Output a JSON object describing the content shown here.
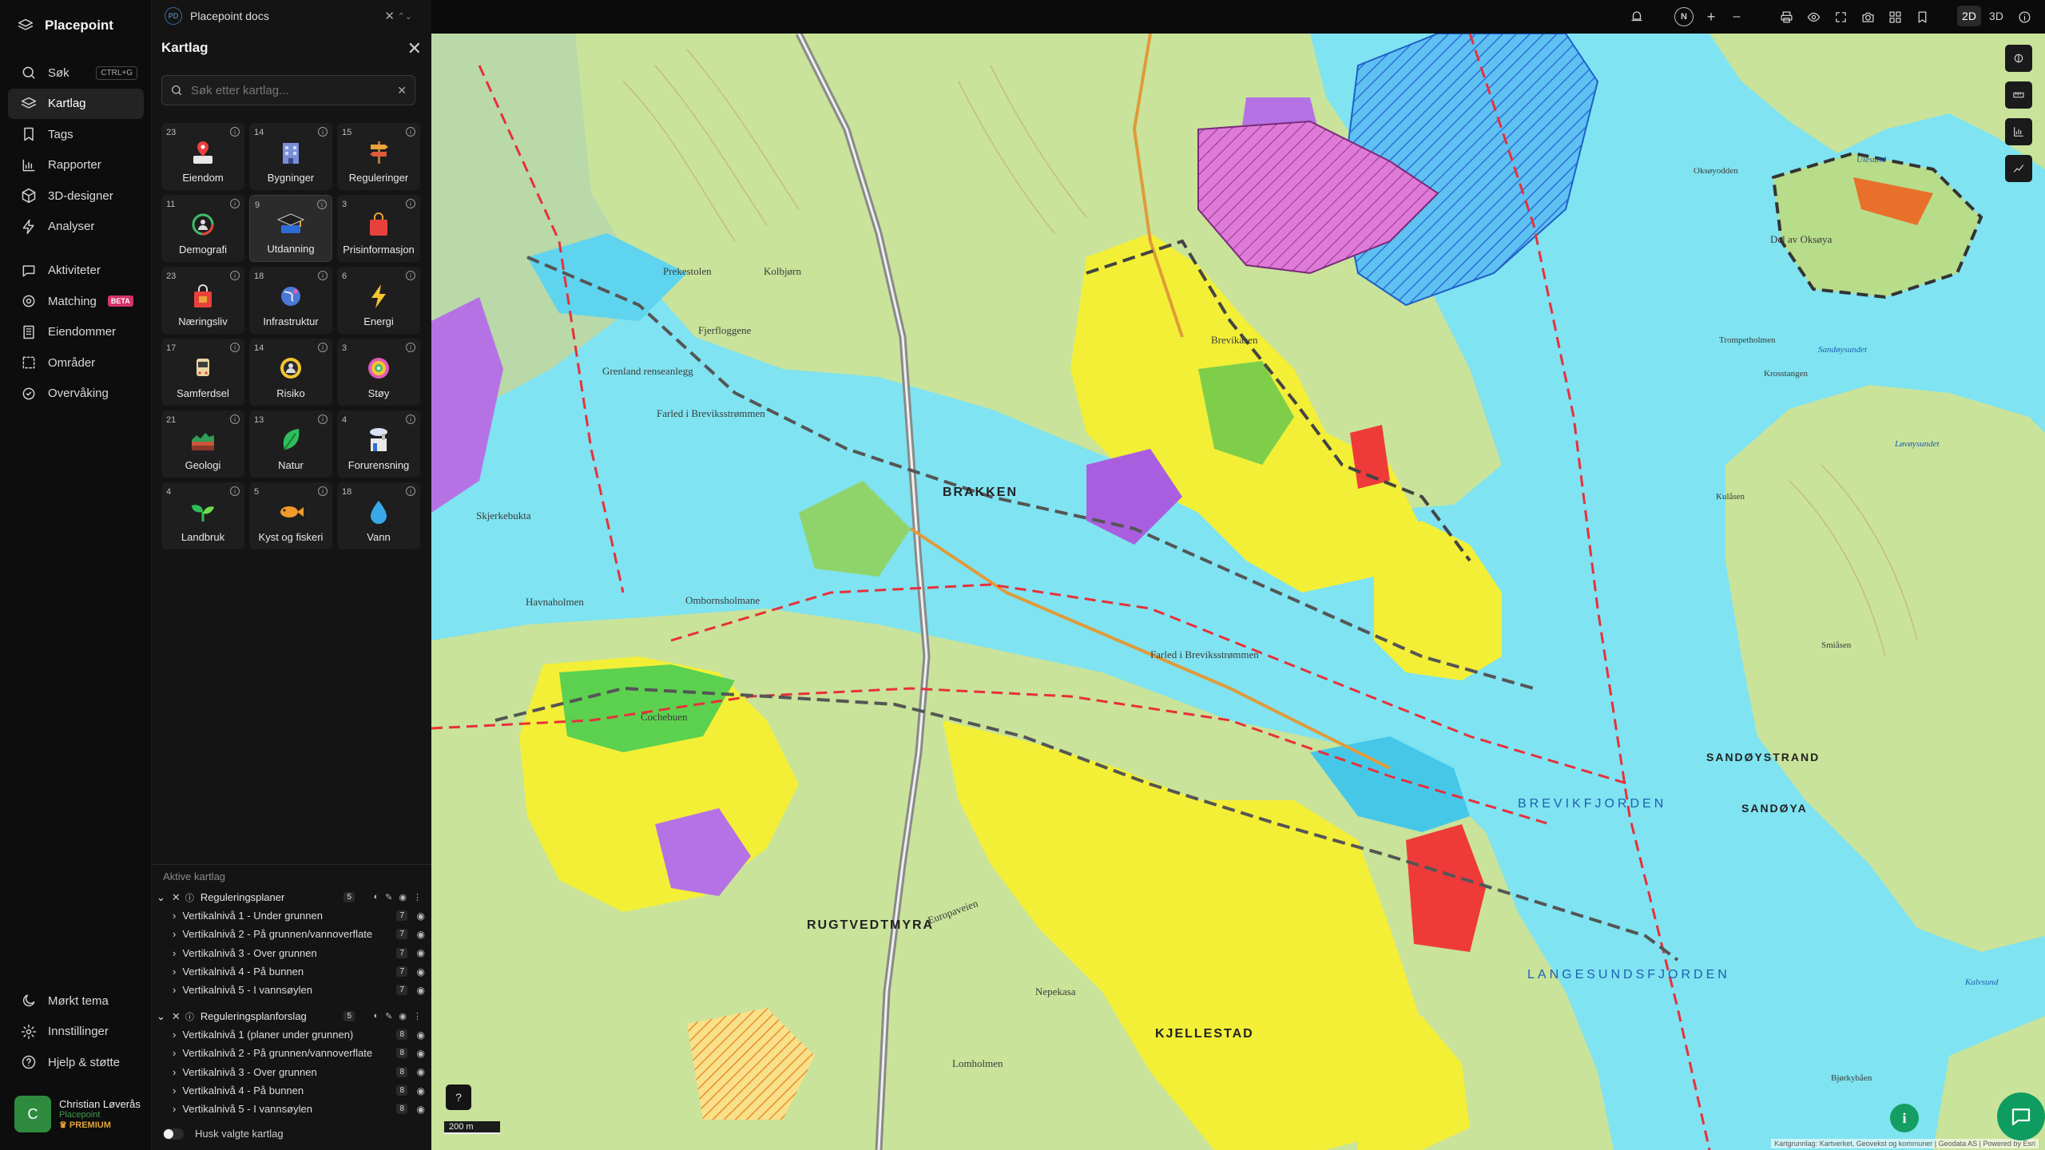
{
  "app": {
    "brand": "Placepoint"
  },
  "nav": {
    "items": [
      {
        "label": "Søk",
        "shortcut": "CTRL+G"
      },
      {
        "label": "Kartlag"
      },
      {
        "label": "Tags"
      },
      {
        "label": "Rapporter"
      },
      {
        "label": "3D-designer"
      },
      {
        "label": "Analyser"
      },
      {
        "label": "Aktiviteter"
      },
      {
        "label": "Matching",
        "badge": "BETA"
      },
      {
        "label": "Eiendommer"
      },
      {
        "label": "Områder"
      },
      {
        "label": "Overvåking"
      }
    ],
    "bottom": [
      {
        "label": "Mørkt tema"
      },
      {
        "label": "Innstillinger"
      },
      {
        "label": "Hjelp & støtte"
      }
    ],
    "user": {
      "initial": "C",
      "name": "Christian Løverås",
      "org": "Placepoint",
      "plan": "PREMIUM"
    }
  },
  "doc_tab": {
    "badge": "PD",
    "title": "Placepoint docs"
  },
  "panel": {
    "title": "Kartlag",
    "search_placeholder": "Søk etter kartlag...",
    "categories": [
      {
        "count": "23",
        "label": "Eiendom"
      },
      {
        "count": "14",
        "label": "Bygninger"
      },
      {
        "count": "15",
        "label": "Reguleringer"
      },
      {
        "count": "11",
        "label": "Demografi"
      },
      {
        "count": "9",
        "label": "Utdanning"
      },
      {
        "count": "3",
        "label": "Prisinformasjon"
      },
      {
        "count": "23",
        "label": "Næringsliv"
      },
      {
        "count": "18",
        "label": "Infrastruktur"
      },
      {
        "count": "6",
        "label": "Energi"
      },
      {
        "count": "17",
        "label": "Samferdsel"
      },
      {
        "count": "14",
        "label": "Risiko"
      },
      {
        "count": "3",
        "label": "Støy"
      },
      {
        "count": "21",
        "label": "Geologi"
      },
      {
        "count": "13",
        "label": "Natur"
      },
      {
        "count": "4",
        "label": "Forurensning"
      },
      {
        "count": "4",
        "label": "Landbruk"
      },
      {
        "count": "5",
        "label": "Kyst og fiskeri"
      },
      {
        "count": "18",
        "label": "Vann"
      }
    ],
    "active_header": "Aktive kartlag",
    "active_groups": [
      {
        "name": "Reguleringsplaner",
        "count": "5",
        "layers": [
          {
            "name": "Vertikalnivå 1 - Under grunnen",
            "count": "7"
          },
          {
            "name": "Vertikalnivå 2 - På grunnen/vannoverflate",
            "count": "7"
          },
          {
            "name": "Vertikalnivå 3 - Over grunnen",
            "count": "7"
          },
          {
            "name": "Vertikalnivå 4 - På bunnen",
            "count": "7"
          },
          {
            "name": "Vertikalnivå 5 - I vannsøylen",
            "count": "7"
          }
        ]
      },
      {
        "name": "Reguleringsplanforslag",
        "count": "5",
        "layers": [
          {
            "name": "Vertikalnivå 1 (planer under grunnen)",
            "count": "8"
          },
          {
            "name": "Vertikalnivå 2 - På grunnen/vannoverflate",
            "count": "8"
          },
          {
            "name": "Vertikalnivå 3 - Over grunnen",
            "count": "8"
          },
          {
            "name": "Vertikalnivå 4 - På bunnen",
            "count": "8"
          },
          {
            "name": "Vertikalnivå 5 - I vannsøylen",
            "count": "8"
          }
        ]
      }
    ],
    "remember_label": "Husk valgte kartlag"
  },
  "topbar": {
    "north": "N",
    "zoom_in": "+",
    "zoom_out": "–",
    "mode_2d": "2D",
    "mode_3d": "3D"
  },
  "map": {
    "scale": "200 m",
    "attribution": "Kartgrunnlag: Kartverket, Geovekst og kommuner | Geodata AS | Powered by Esri",
    "labels": {
      "brevikfjorden": "BREVIKFJORDEN",
      "langesundsfjorden": "LANGESUNDSFJORDEN",
      "brakken": "BRAKKEN",
      "rugtvedtmyra": "RUGTVEDTMYRA",
      "kjellestad": "KJELLESTAD",
      "sandoystrand": "SANDØYSTRAND",
      "sandoya": "SANDØYA",
      "grenland": "Grenland renseanlegg",
      "farled1": "Farled i Breviksstrømmen",
      "farled2": "Farled i Breviksstrømmen",
      "skjerkebukta": "Skjerkebukta",
      "havnaholmen": "Havnaholmen",
      "ombornsholmane": "Ombornsholmane",
      "lomholmen": "Lomholmen",
      "nepekasa": "Nepekasa",
      "prekestolen": "Prekestolen",
      "kolbjorn": "Kolbjørn",
      "breviksen": "Brevikåsen",
      "del_av_oksoya": "Del av Oksøya",
      "europaveien": "Europaveien",
      "cochebuen": "Cochebuen",
      "oksoyodden": "Oksøyodden",
      "trompetholmen": "Trompetholmen",
      "krosstangen": "Krosstangen",
      "kulasen": "Kulåsen",
      "smiasen": "Smiåsen",
      "bjorkybaaen": "Bjørkybåen",
      "fjerfloggene": "Fjerfloggene",
      "sandoysundet": "Sandøysundet",
      "lavoysundet": "Løvøysundet",
      "ulesund": "Ulesund",
      "kalvsund": "Kalvsund"
    }
  }
}
